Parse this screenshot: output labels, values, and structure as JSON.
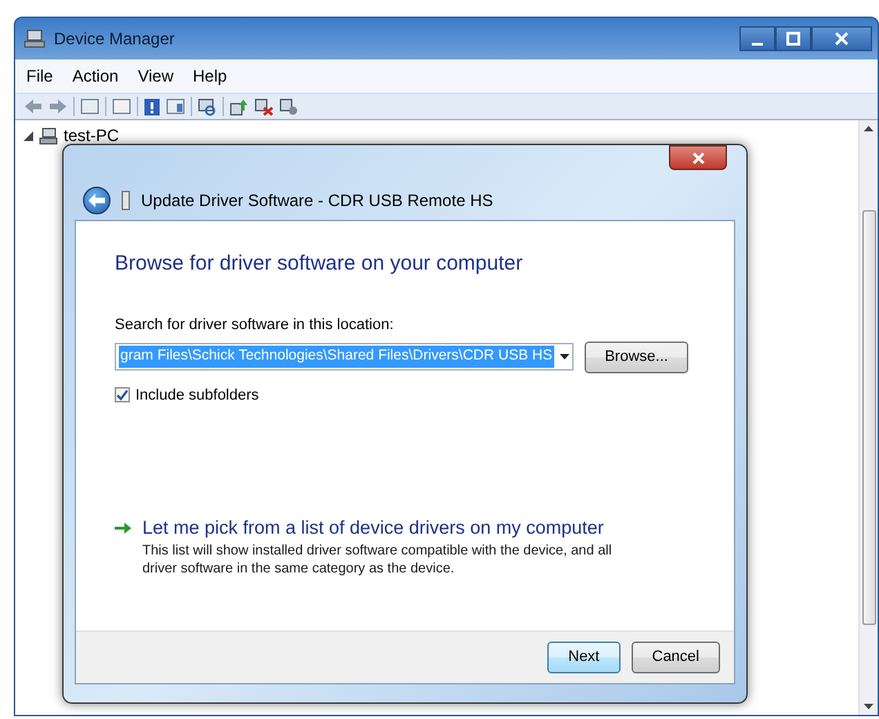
{
  "window": {
    "title": "Device Manager"
  },
  "menu": [
    "File",
    "Action",
    "View",
    "Help"
  ],
  "tree": {
    "label": "test-PC",
    "expanded": true
  },
  "dialog": {
    "title": "Update Driver Software - CDR USB Remote HS",
    "heading": "Browse for driver software on your computer",
    "location_label": "Search for driver software in this location:",
    "path": {
      "value": "gram Files\\Schick Technologies\\Shared Files\\Drivers\\CDR USB HS",
      "selected": true
    },
    "browse_button": "Browse...",
    "include_subfolders": {
      "label": "Include subfolders",
      "checked": true
    },
    "option": {
      "title": "Let me pick from a list of device drivers on my computer",
      "description": "This list will show installed driver software compatible with the device, and all driver software in the same category as the device."
    },
    "buttons": [
      {
        "label": "Next",
        "default": true
      },
      {
        "label": "Cancel",
        "default": false
      }
    ]
  }
}
